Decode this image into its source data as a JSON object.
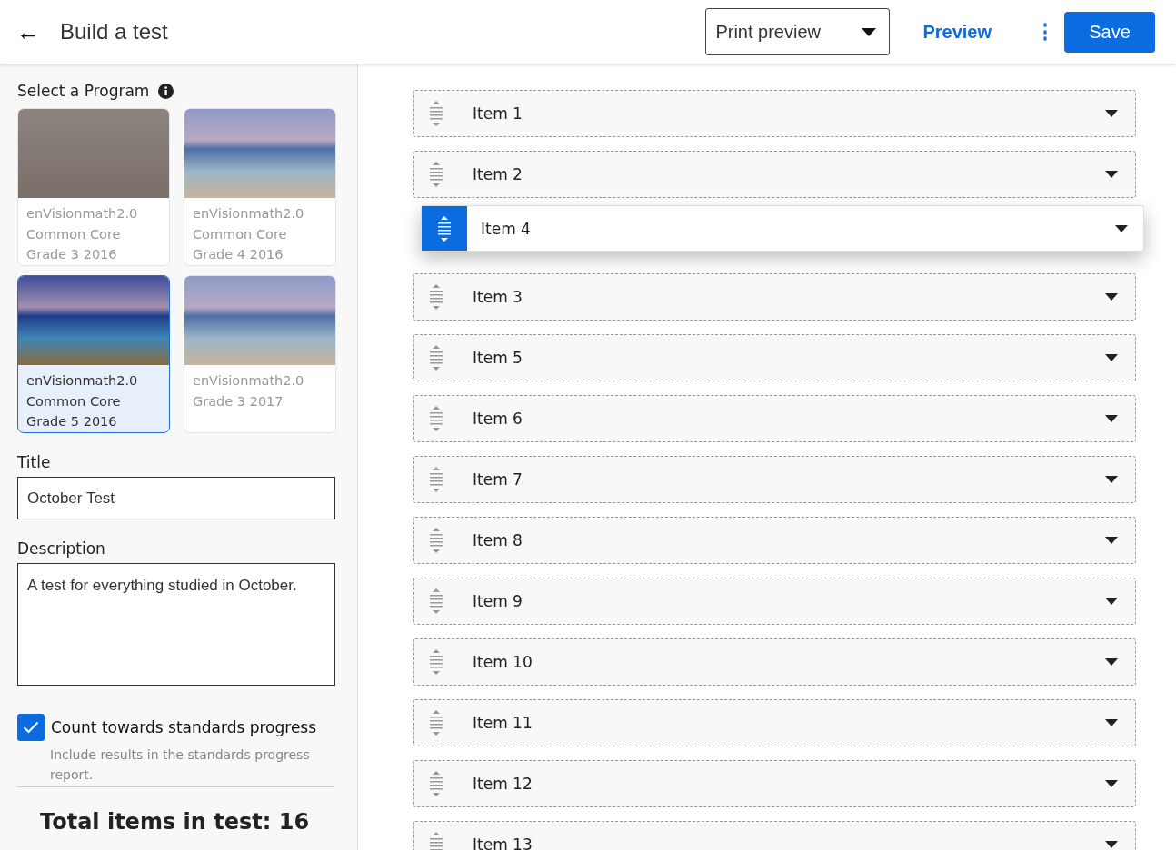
{
  "header": {
    "back": "←",
    "title": "Build a test",
    "print_select": {
      "value": "Print preview"
    },
    "preview": "Preview",
    "more": "⋮",
    "save": "Save"
  },
  "sidebar": {
    "program_label": "Select a Program",
    "programs": [
      {
        "lines": [
          "enVisionmath2.0",
          "Common Core",
          "Grade 3 2016"
        ],
        "selected": false,
        "kind": "cave"
      },
      {
        "lines": [
          "enVisionmath2.0",
          "Common Core",
          "Grade 4 2016"
        ],
        "selected": false,
        "kind": "beach"
      },
      {
        "lines": [
          "enVisionmath2.0",
          "Common Core",
          "Grade 5 2016"
        ],
        "selected": true,
        "kind": "beach"
      },
      {
        "lines": [
          "enVisionmath2.0",
          "Grade 3 2017"
        ],
        "selected": false,
        "kind": "beach"
      }
    ],
    "title_label": "Title",
    "title_value": "October Test",
    "description_label": "Description",
    "description_value": "A test for everything studied in October.",
    "standards": {
      "label": "Count towards standards progress",
      "hint": "Include results in the standards progress report.",
      "checked": true
    },
    "total": "Total items in test: 16"
  },
  "items": [
    {
      "label": "Item 1",
      "dragging": false
    },
    {
      "label": "Item 2",
      "dragging": false
    },
    {
      "label": "Item 4",
      "dragging": true
    },
    {
      "label": "Item 3",
      "dragging": false
    },
    {
      "label": "Item 5",
      "dragging": false
    },
    {
      "label": "Item 6",
      "dragging": false
    },
    {
      "label": "Item 7",
      "dragging": false
    },
    {
      "label": "Item 8",
      "dragging": false
    },
    {
      "label": "Item 9",
      "dragging": false
    },
    {
      "label": "Item 10",
      "dragging": false
    },
    {
      "label": "Item 11",
      "dragging": false
    },
    {
      "label": "Item 12",
      "dragging": false
    },
    {
      "label": "Item 13",
      "dragging": false
    }
  ]
}
